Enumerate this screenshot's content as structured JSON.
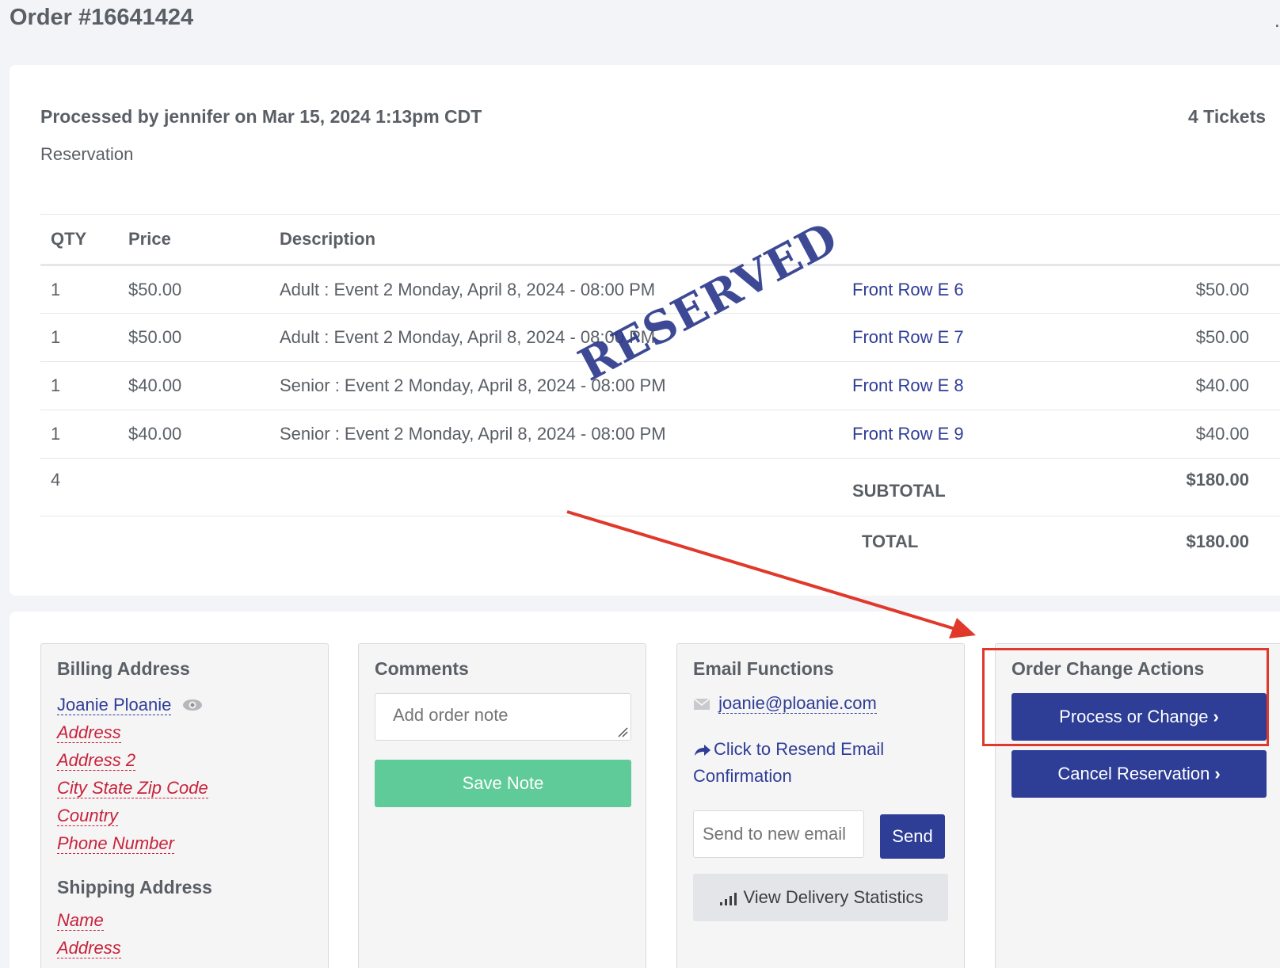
{
  "page": {
    "title": "Order #16641424"
  },
  "order": {
    "processed_line": "Processed by jennifer on Mar 15, 2024 1:13pm CDT",
    "tickets": "4 Tickets",
    "type": "Reservation",
    "stamp": "RESERVED"
  },
  "items_table": {
    "headers": {
      "qty": "QTY",
      "price": "Price",
      "description": "Description"
    },
    "rows": [
      {
        "qty": "1",
        "price": "$50.00",
        "description": "Adult : Event 2 Monday, April 8, 2024 - 08:00 PM",
        "seat": "Front Row E 6",
        "amount": "$50.00"
      },
      {
        "qty": "1",
        "price": "$50.00",
        "description": "Adult : Event 2 Monday, April 8, 2024 - 08:00 PM",
        "seat": "Front Row E 7",
        "amount": "$50.00"
      },
      {
        "qty": "1",
        "price": "$40.00",
        "description": "Senior : Event 2 Monday, April 8, 2024 - 08:00 PM",
        "seat": "Front Row E 8",
        "amount": "$40.00"
      },
      {
        "qty": "1",
        "price": "$40.00",
        "description": "Senior : Event 2 Monday, April 8, 2024 - 08:00 PM",
        "seat": "Front Row E 9",
        "amount": "$40.00"
      }
    ],
    "summary": {
      "total_qty": "4",
      "subtotal_label": "SUBTOTAL",
      "subtotal_value": "$180.00",
      "total_label": "TOTAL",
      "total_value": "$180.00"
    }
  },
  "billing": {
    "title": "Billing Address",
    "name": "Joanie Ploanie",
    "address": "Address",
    "address2": "Address 2",
    "city_state_zip": "City State Zip Code",
    "country": "Country",
    "phone": "Phone Number"
  },
  "shipping": {
    "title": "Shipping Address",
    "name": "Name",
    "address": "Address"
  },
  "comments": {
    "title": "Comments",
    "placeholder": "Add order note",
    "save_label": "Save Note"
  },
  "email_functions": {
    "title": "Email Functions",
    "email": "joanie@ploanie.com",
    "resend_label": "Click to Resend Email Confirmation",
    "send_placeholder": "Send to new email",
    "send_label": "Send",
    "stats_label": "View Delivery Statistics"
  },
  "order_actions": {
    "title": "Order Change Actions",
    "process_label": "Process or Change",
    "cancel_label": "Cancel Reservation"
  },
  "colors": {
    "primary": "#2e3d96",
    "success": "#5fcb98",
    "danger_link": "#c8223a",
    "annotation": "#e0392b"
  }
}
